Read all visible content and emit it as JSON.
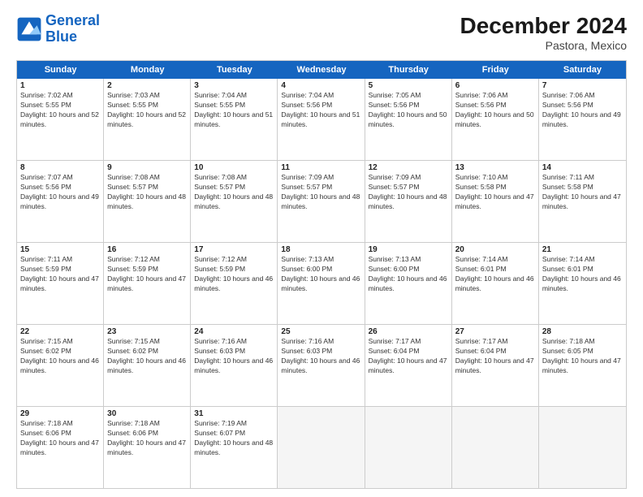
{
  "logo": {
    "line1": "General",
    "line2": "Blue"
  },
  "title": "December 2024",
  "subtitle": "Pastora, Mexico",
  "days": [
    "Sunday",
    "Monday",
    "Tuesday",
    "Wednesday",
    "Thursday",
    "Friday",
    "Saturday"
  ],
  "rows": [
    [
      {
        "day": "1",
        "sunrise": "Sunrise: 7:02 AM",
        "sunset": "Sunset: 5:55 PM",
        "daylight": "Daylight: 10 hours and 52 minutes."
      },
      {
        "day": "2",
        "sunrise": "Sunrise: 7:03 AM",
        "sunset": "Sunset: 5:55 PM",
        "daylight": "Daylight: 10 hours and 52 minutes."
      },
      {
        "day": "3",
        "sunrise": "Sunrise: 7:04 AM",
        "sunset": "Sunset: 5:55 PM",
        "daylight": "Daylight: 10 hours and 51 minutes."
      },
      {
        "day": "4",
        "sunrise": "Sunrise: 7:04 AM",
        "sunset": "Sunset: 5:56 PM",
        "daylight": "Daylight: 10 hours and 51 minutes."
      },
      {
        "day": "5",
        "sunrise": "Sunrise: 7:05 AM",
        "sunset": "Sunset: 5:56 PM",
        "daylight": "Daylight: 10 hours and 50 minutes."
      },
      {
        "day": "6",
        "sunrise": "Sunrise: 7:06 AM",
        "sunset": "Sunset: 5:56 PM",
        "daylight": "Daylight: 10 hours and 50 minutes."
      },
      {
        "day": "7",
        "sunrise": "Sunrise: 7:06 AM",
        "sunset": "Sunset: 5:56 PM",
        "daylight": "Daylight: 10 hours and 49 minutes."
      }
    ],
    [
      {
        "day": "8",
        "sunrise": "Sunrise: 7:07 AM",
        "sunset": "Sunset: 5:56 PM",
        "daylight": "Daylight: 10 hours and 49 minutes."
      },
      {
        "day": "9",
        "sunrise": "Sunrise: 7:08 AM",
        "sunset": "Sunset: 5:57 PM",
        "daylight": "Daylight: 10 hours and 48 minutes."
      },
      {
        "day": "10",
        "sunrise": "Sunrise: 7:08 AM",
        "sunset": "Sunset: 5:57 PM",
        "daylight": "Daylight: 10 hours and 48 minutes."
      },
      {
        "day": "11",
        "sunrise": "Sunrise: 7:09 AM",
        "sunset": "Sunset: 5:57 PM",
        "daylight": "Daylight: 10 hours and 48 minutes."
      },
      {
        "day": "12",
        "sunrise": "Sunrise: 7:09 AM",
        "sunset": "Sunset: 5:57 PM",
        "daylight": "Daylight: 10 hours and 48 minutes."
      },
      {
        "day": "13",
        "sunrise": "Sunrise: 7:10 AM",
        "sunset": "Sunset: 5:58 PM",
        "daylight": "Daylight: 10 hours and 47 minutes."
      },
      {
        "day": "14",
        "sunrise": "Sunrise: 7:11 AM",
        "sunset": "Sunset: 5:58 PM",
        "daylight": "Daylight: 10 hours and 47 minutes."
      }
    ],
    [
      {
        "day": "15",
        "sunrise": "Sunrise: 7:11 AM",
        "sunset": "Sunset: 5:59 PM",
        "daylight": "Daylight: 10 hours and 47 minutes."
      },
      {
        "day": "16",
        "sunrise": "Sunrise: 7:12 AM",
        "sunset": "Sunset: 5:59 PM",
        "daylight": "Daylight: 10 hours and 47 minutes."
      },
      {
        "day": "17",
        "sunrise": "Sunrise: 7:12 AM",
        "sunset": "Sunset: 5:59 PM",
        "daylight": "Daylight: 10 hours and 46 minutes."
      },
      {
        "day": "18",
        "sunrise": "Sunrise: 7:13 AM",
        "sunset": "Sunset: 6:00 PM",
        "daylight": "Daylight: 10 hours and 46 minutes."
      },
      {
        "day": "19",
        "sunrise": "Sunrise: 7:13 AM",
        "sunset": "Sunset: 6:00 PM",
        "daylight": "Daylight: 10 hours and 46 minutes."
      },
      {
        "day": "20",
        "sunrise": "Sunrise: 7:14 AM",
        "sunset": "Sunset: 6:01 PM",
        "daylight": "Daylight: 10 hours and 46 minutes."
      },
      {
        "day": "21",
        "sunrise": "Sunrise: 7:14 AM",
        "sunset": "Sunset: 6:01 PM",
        "daylight": "Daylight: 10 hours and 46 minutes."
      }
    ],
    [
      {
        "day": "22",
        "sunrise": "Sunrise: 7:15 AM",
        "sunset": "Sunset: 6:02 PM",
        "daylight": "Daylight: 10 hours and 46 minutes."
      },
      {
        "day": "23",
        "sunrise": "Sunrise: 7:15 AM",
        "sunset": "Sunset: 6:02 PM",
        "daylight": "Daylight: 10 hours and 46 minutes."
      },
      {
        "day": "24",
        "sunrise": "Sunrise: 7:16 AM",
        "sunset": "Sunset: 6:03 PM",
        "daylight": "Daylight: 10 hours and 46 minutes."
      },
      {
        "day": "25",
        "sunrise": "Sunrise: 7:16 AM",
        "sunset": "Sunset: 6:03 PM",
        "daylight": "Daylight: 10 hours and 46 minutes."
      },
      {
        "day": "26",
        "sunrise": "Sunrise: 7:17 AM",
        "sunset": "Sunset: 6:04 PM",
        "daylight": "Daylight: 10 hours and 47 minutes."
      },
      {
        "day": "27",
        "sunrise": "Sunrise: 7:17 AM",
        "sunset": "Sunset: 6:04 PM",
        "daylight": "Daylight: 10 hours and 47 minutes."
      },
      {
        "day": "28",
        "sunrise": "Sunrise: 7:18 AM",
        "sunset": "Sunset: 6:05 PM",
        "daylight": "Daylight: 10 hours and 47 minutes."
      }
    ],
    [
      {
        "day": "29",
        "sunrise": "Sunrise: 7:18 AM",
        "sunset": "Sunset: 6:06 PM",
        "daylight": "Daylight: 10 hours and 47 minutes."
      },
      {
        "day": "30",
        "sunrise": "Sunrise: 7:18 AM",
        "sunset": "Sunset: 6:06 PM",
        "daylight": "Daylight: 10 hours and 47 minutes."
      },
      {
        "day": "31",
        "sunrise": "Sunrise: 7:19 AM",
        "sunset": "Sunset: 6:07 PM",
        "daylight": "Daylight: 10 hours and 48 minutes."
      },
      null,
      null,
      null,
      null
    ]
  ]
}
